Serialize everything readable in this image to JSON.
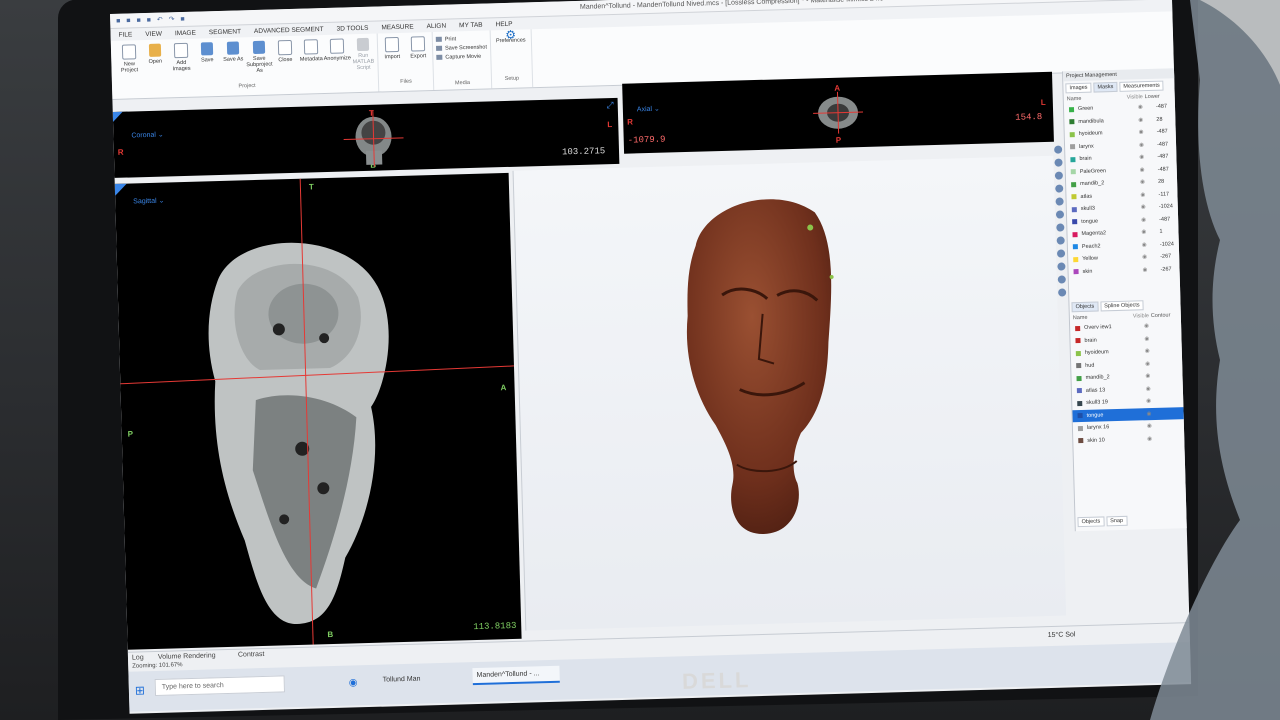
{
  "app": {
    "quick_access": "■ ■ ■ ■ ↶ ↷ ■",
    "title": "Manden^Tollund - MandenTollund Nived.mcs - [Lossless Compression] * - Materialise Mimics 24.0",
    "window_controls": "– □ ×"
  },
  "menu": [
    "FILE",
    "VIEW",
    "IMAGE",
    "SEGMENT",
    "ADVANCED SEGMENT",
    "3D TOOLS",
    "MEASURE",
    "ALIGN",
    "MY TAB",
    "HELP"
  ],
  "ribbon": {
    "project": {
      "caption": "Project",
      "buttons": [
        "New Project",
        "Open",
        "Add Images",
        "Save",
        "Save As",
        "Save Subproject As",
        "Close",
        "Metadata",
        "Anonymize",
        "Run MATLAB Script"
      ]
    },
    "files": {
      "caption": "Files",
      "buttons": [
        "Import",
        "Export"
      ]
    },
    "media": {
      "caption": "Media",
      "buttons": [
        "Print",
        "Save Screenshot",
        "Capture Movie"
      ]
    },
    "setup": {
      "caption": "Setup",
      "buttons": [
        "Preferences"
      ]
    }
  },
  "views": {
    "coronal": {
      "label": "Coronal ⌄",
      "value": "103.2715",
      "left": "R",
      "right": "L",
      "top": "T",
      "bottom": "B"
    },
    "axial": {
      "label": "Axial ⌄",
      "value_left": "-1079.9",
      "value_right": "154.8",
      "left": "R",
      "right": "L",
      "top": "A",
      "bottom": "P"
    },
    "sagittal": {
      "label": "Sagittal ⌄",
      "value": "113.8183",
      "top": "T",
      "bottom": "B",
      "left": "P",
      "right": "A"
    }
  },
  "project_management": {
    "header": "Project Management",
    "tabs": [
      "Images",
      "Masks",
      "Measurements"
    ],
    "columns": [
      "Name",
      "Visible",
      "Lower"
    ],
    "masks": [
      {
        "name": "Green",
        "color": "#38b24a",
        "lower": "-487"
      },
      {
        "name": "mandibula",
        "color": "#2e7d32",
        "lower": "28"
      },
      {
        "name": "hyoideum",
        "color": "#8bc34a",
        "lower": "-487"
      },
      {
        "name": "larynx",
        "color": "#9e9e9e",
        "lower": "-487"
      },
      {
        "name": "brain",
        "color": "#26a69a",
        "lower": "-487"
      },
      {
        "name": "PaleGreen",
        "color": "#a5d6a7",
        "lower": "-487"
      },
      {
        "name": "mandib_2",
        "color": "#43a047",
        "lower": "28"
      },
      {
        "name": "atlas",
        "color": "#c0ca33",
        "lower": "-117"
      },
      {
        "name": "skull3",
        "color": "#5c6bc0",
        "lower": "-1024"
      },
      {
        "name": "tongue",
        "color": "#3949ab",
        "lower": "-487"
      },
      {
        "name": "Magenta2",
        "color": "#d81b60",
        "lower": "1"
      },
      {
        "name": "Peach2",
        "color": "#1e88e5",
        "lower": "-1024"
      },
      {
        "name": "Yellow",
        "color": "#fdd835",
        "lower": "-267"
      },
      {
        "name": "skin",
        "color": "#ab47bc",
        "lower": "-267"
      }
    ],
    "object_tabs": [
      "Objects",
      "Spline Objects"
    ],
    "object_columns": [
      "Name",
      "Visible",
      "Contour"
    ],
    "objects": [
      {
        "name": "Overv iew1",
        "color": "#c62828",
        "selected": false
      },
      {
        "name": "brain",
        "color": "#c62828",
        "selected": false
      },
      {
        "name": "hyoideum",
        "color": "#8bc34a",
        "selected": false
      },
      {
        "name": "hud",
        "color": "#757575",
        "selected": false
      },
      {
        "name": "mandib_2",
        "color": "#43a047",
        "selected": false
      },
      {
        "name": "atlas 13",
        "color": "#5c6bc0",
        "selected": false
      },
      {
        "name": "skull3 19",
        "color": "#37474f",
        "selected": false
      },
      {
        "name": "tongue",
        "color": "#1e4fa8",
        "selected": true
      },
      {
        "name": "larynx 16",
        "color": "#9e9e9e",
        "selected": false
      },
      {
        "name": "skin 10",
        "color": "#6d4c41",
        "selected": false
      }
    ],
    "bottom_tabs": [
      "Objects",
      "Snap"
    ]
  },
  "status_bar": {
    "tabs": [
      "Log",
      "Volume Rendering",
      "Contrast"
    ],
    "zoom": "Zooming: 101.67%"
  },
  "taskbar": {
    "search": "Type here to search",
    "items": [
      "Tollund Man",
      "Manden^Tollund - ..."
    ],
    "tray": "15°C Sol"
  },
  "monitor_brand": "DELL",
  "colors": {
    "accent": "#1f6fd8",
    "view_label": "#3a86e8",
    "crosshair": "#e53935",
    "skin": "#7a3a22"
  }
}
